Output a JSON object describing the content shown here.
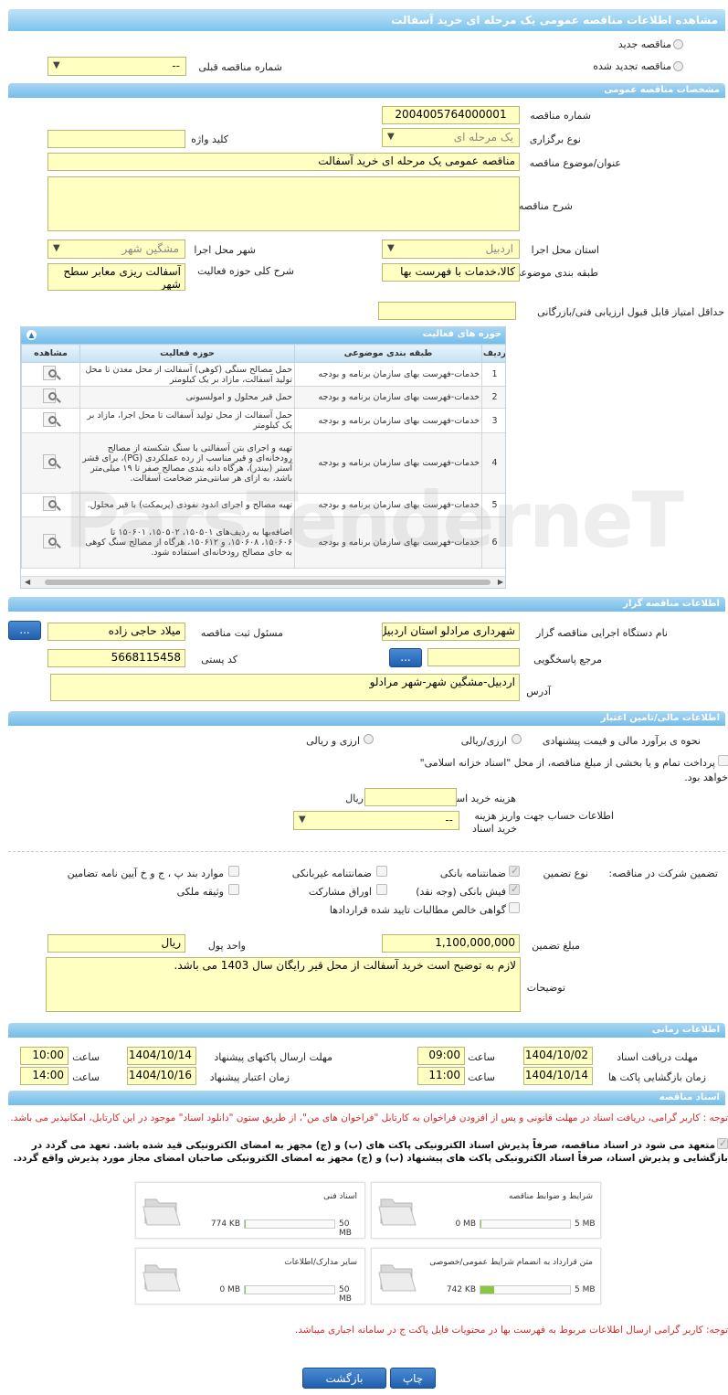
{
  "title": "مشاهده اطلاعات مناقصه عمومی یک مرحله ای خرید آسفالت",
  "radio_new": "مناقصه جدید",
  "radio_renewed": "مناقصه تجدید شده",
  "prev_tender_label": "شماره مناقصه قبلی",
  "prev_tender_value": "--",
  "sec_general": "مشخصات مناقصه عمومی",
  "tender_number_label": "شماره مناقصه",
  "tender_number": "2004005764000001",
  "type_label": "نوع برگزاری",
  "type_value": "یک مرحله ای",
  "keyword_label": "کلید واژه",
  "subject_label": "عنوان/موضوع مناقصه",
  "subject_value": "مناقصه عمومی یک مرحله ای خرید آسفالت",
  "desc_label": "شرح مناقصه",
  "province_label": "استان محل اجرا",
  "province_value": "اردبیل",
  "city_label": "شهر محل اجرا",
  "city_value": "مشگین شهر",
  "category_label": "طبقه بندی موضوعی",
  "category_value": "کالا،خدمات با فهرست بها",
  "activity_desc_label": "شرح کلی حوزه فعالیت",
  "activity_desc_value": "آسفالت ریزی معابر سطح شهر",
  "min_score_label": "حداقل امتیاز قابل قبول ارزیابی فنی/بازرگانی",
  "activities_title": "حوزه های فعالیت",
  "cols": {
    "row": "ردیف",
    "cat": "طبقه بندی موضوعی",
    "act": "حوزه فعالیت",
    "view": "مشاهده"
  },
  "rows": [
    {
      "n": "1",
      "cat": "خدمات-فهرست بهای سازمان برنامه و بودجه",
      "act": "حمل مصالح سنگی (کوهی) آسفالت از محل معدن تا محل تولید آسفالت، مازاد بر یک کیلومتر"
    },
    {
      "n": "2",
      "cat": "خدمات-فهرست بهای سازمان برنامه و بودجه",
      "act": "حمل قیر محلول و امولسیونی"
    },
    {
      "n": "3",
      "cat": "خدمات-فهرست بهای سازمان برنامه و بودجه",
      "act": "حمل آسفالت از محل تولید آسفالت تا محل اجرا، مازاد بر یک کیلومتر"
    },
    {
      "n": "4",
      "cat": "خدمات-فهرست بهای سازمان برنامه و بودجه",
      "act": "تهیه و اجرای بتن آسفالتی با سنگ شکسته از مصالح رودخانه‌ای و قیر مناسب از رده عملکردی (PG)، برای قشر آستر (بیندر)، هرگاه دانه بندی مصالح صفر تا ۱۹ میلی‌متر باشد، به ازای هر سانتی‌متر ضخامت آسفالت."
    },
    {
      "n": "5",
      "cat": "خدمات-فهرست بهای سازمان برنامه و بودجه",
      "act": "تهیه مصالح و اجرای اندود نفوذی (پریمکت) با قیر محلول."
    },
    {
      "n": "6",
      "cat": "خدمات-فهرست بهای سازمان برنامه و بودجه",
      "act": "اضافه‌بها به ردیف‌های ۱۵۰۵۰۱، ۱۵۰۵۰۲، ۱۵۰۶۰۱ تا ۱۵۰۶۰۶، ۱۵۰۶۰۸، و ۱۵۰۶۱۲، هرگاه از مصالح سنگ کوهی به جای مصالح رودخانه‌ای استفاده شود."
    }
  ],
  "sec_holder": "اطلاعات مناقصه گزار",
  "org_label": "نام دستگاه اجرایی مناقصه گزار",
  "org_value": "شهرداری مرادلو استان اردبیل",
  "registrar_label": "مسئول ثبت مناقصه",
  "registrar_value": "میلاد حاجی زاده",
  "ref_label": "مرجع پاسخگویی",
  "postal_label": "کد پستی",
  "postal_value": "5668115458",
  "address_label": "آدرس",
  "address_value": "اردبیل-مشگین شهر-شهر مرادلو",
  "dots": "...",
  "sec_fin": "اطلاعات مالی/تامین اعتبار",
  "estimate_label": "نحوه ی برآورد مالی و قیمت پیشنهادی",
  "opt_rial": "ارزی/ریالی",
  "opt_currency": "ارزی و ریالی",
  "treasury_text1": "پرداخت تمام و یا بخشی از مبلغ مناقصه، از محل \"اسناد خزانه اسلامی\"",
  "treasury_text2": "خواهد بود.",
  "doc_cost_label": "هزینه خرید اسناد",
  "doc_cost_unit": "ریال",
  "account_label1": "اطلاعات حساب جهت واریز هزینه",
  "account_label2": "خرید اسناد",
  "account_value": "--",
  "guarantee_label": "تضمین شرکت در مناقصه:",
  "guarantee_type_label": "نوع تضمین",
  "g1": "ضمانتنامه بانکی",
  "g2": "ضمانتنامه غیربانکی",
  "g3": "موارد بند پ ، ج و خ آیین نامه تضامین",
  "g4": "فیش بانکی (وجه نقد)",
  "g5": "اوراق مشارکت",
  "g6": "وثیقه ملکی",
  "g7": "گواهی خالص مطالبات تایید شده قراردادها",
  "amount_label": "مبلغ تضمین",
  "amount_value": "1,100,000,000",
  "currency_label": "واحد پول",
  "currency_value": "ریال",
  "notes_label": "توضیحات",
  "notes_value": "لازم به توضیح است خرید آسفالت از محل قیر رایگان سال 1403 می باشد.",
  "sec_time": "اطلاعات زمانی",
  "t_doc_receive": "مهلت دریافت اسناد",
  "t_doc_receive_date": "1404/10/02",
  "t_doc_receive_time": "09:00",
  "t_send": "مهلت ارسال پاکتهای پیشنهاد",
  "t_send_date": "1404/10/14",
  "t_send_time": "10:00",
  "t_open": "زمان بازگشایی پاکت ها",
  "t_open_date": "1404/10/14",
  "t_open_time": "11:00",
  "t_validity": "زمان اعتبار پیشنهاد",
  "t_validity_date": "1404/10/16",
  "t_validity_time": "14:00",
  "time_word": "ساعت",
  "sec_docs": "اسناد مناقصه",
  "docs_note": "توجه : کاربر گرامی، دریافت اسناد در مهلت قانونی و پس از افزودن فراخوان به کارتابل \"فراخوان های من\"، از طریق ستون \"دانلود اسناد\" موجود در این کارتابل، امکانپذیر می باشد.",
  "commit_text": "متعهد می شود در اسناد مناقصه، صرفاً پذیرش اسناد الکترونیکی پاکت های (ب) و (ج) مجهز به امضای الکترونیکی قید شده باشد. تعهد می گردد در بازگشایی و پذیرش اسناد، صرفاً اسناد الکترونیکی پاکت های پیشنهاد (ب) و (ج) مجهز به امضای الکترونیکی صاحبان امضای مجاز مورد پذیرش واقع گردد.",
  "cards": [
    {
      "title": "شرایط و ضوابط مناقصه",
      "current": "0 MB",
      "max": "5 MB",
      "fill": 0
    },
    {
      "title": "اسناد فنی",
      "current": "774 KB",
      "max": "50 MB",
      "fill": 0.015
    },
    {
      "title": "متن قرارداد به انضمام شرایط عمومی/خصوصی",
      "current": "742 KB",
      "max": "5 MB",
      "fill": 0.15
    },
    {
      "title": "سایر مدارک/اطلاعات",
      "current": "0 MB",
      "max": "50 MB",
      "fill": 0
    }
  ],
  "bottom_note": "توجه: کاربر گرامی ارسال اطلاعات مربوط به فهرست بها در محتویات فایل پاکت ج در سامانه اجباری میباشد.",
  "print_btn": "چاپ",
  "back_btn": "بازگشت",
  "watermark": "ParsTenderneT",
  "colors": {
    "field": "#ffffc2",
    "header": "#7dc4ec",
    "button": "#1f5fae",
    "red": "#d52a2a"
  }
}
